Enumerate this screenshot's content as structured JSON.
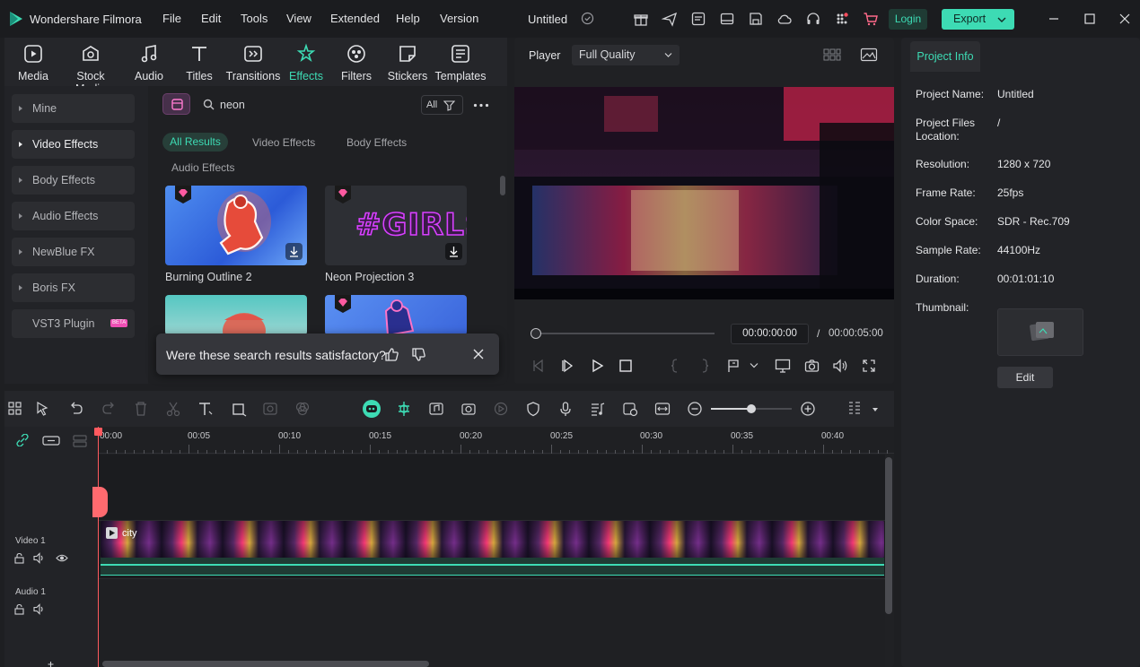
{
  "app": {
    "name": "Wondershare Filmora",
    "project_title": "Untitled"
  },
  "menu": [
    "File",
    "Edit",
    "Tools",
    "View",
    "Extended",
    "Help",
    "Version"
  ],
  "account": {
    "login_label": "Login",
    "export_label": "Export"
  },
  "media_tabs": [
    {
      "label": "Media",
      "icon": "media-icon"
    },
    {
      "label": "Stock Media",
      "icon": "stock-media-icon"
    },
    {
      "label": "Audio",
      "icon": "music-note-icon"
    },
    {
      "label": "Titles",
      "icon": "titles-icon"
    },
    {
      "label": "Transitions",
      "icon": "transitions-icon"
    },
    {
      "label": "Effects",
      "icon": "effects-icon",
      "active": true
    },
    {
      "label": "Filters",
      "icon": "filters-icon"
    },
    {
      "label": "Stickers",
      "icon": "stickers-icon"
    },
    {
      "label": "Templates",
      "icon": "templates-icon"
    }
  ],
  "sidebar": [
    "Mine",
    "Video Effects",
    "Body Effects",
    "Audio Effects",
    "NewBlue FX",
    "Boris FX",
    "VST3 Plugin"
  ],
  "sidebar_badge": "BETA",
  "search": {
    "value": "neon",
    "filter_label": "All"
  },
  "chips": [
    "All Results",
    "Video Effects",
    "Body Effects",
    "Audio Effects"
  ],
  "effects": [
    {
      "label": "Burning Outline 2"
    },
    {
      "label": "Neon Projection 3",
      "preview_text": "#GIRLS"
    }
  ],
  "feedback": {
    "question": "Were these search results satisfactory?"
  },
  "player": {
    "label": "Player",
    "quality": "Full Quality",
    "current_time": "00:00:00:00",
    "separator": "/",
    "total_time": "00:00:05:00"
  },
  "project_info": {
    "tab_label": "Project Info",
    "fields": [
      {
        "label": "Project Name:",
        "value": "Untitled"
      },
      {
        "label": "Project Files\nLocation:",
        "value": "/"
      },
      {
        "label": "Resolution:",
        "value": "1280 x 720"
      },
      {
        "label": "Frame Rate:",
        "value": "25fps"
      },
      {
        "label": "Color Space:",
        "value": "SDR - Rec.709"
      },
      {
        "label": "Sample Rate:",
        "value": "44100Hz"
      },
      {
        "label": "Duration:",
        "value": "00:01:01:10"
      },
      {
        "label": "Thumbnail:",
        "value": ""
      }
    ],
    "edit_label": "Edit"
  },
  "timeline": {
    "ruler": [
      "00:00",
      "00:05",
      "00:10",
      "00:15",
      "00:20",
      "00:25",
      "00:30",
      "00:35",
      "00:40"
    ],
    "tracks": [
      {
        "label": "Video 1"
      },
      {
        "label": "Audio 1"
      }
    ],
    "clip_label": "city"
  },
  "colors": {
    "accent": "#3ddbb4",
    "bg": "#1e1f22",
    "panel": "#25262a",
    "playhead": "#ff5a5f"
  }
}
